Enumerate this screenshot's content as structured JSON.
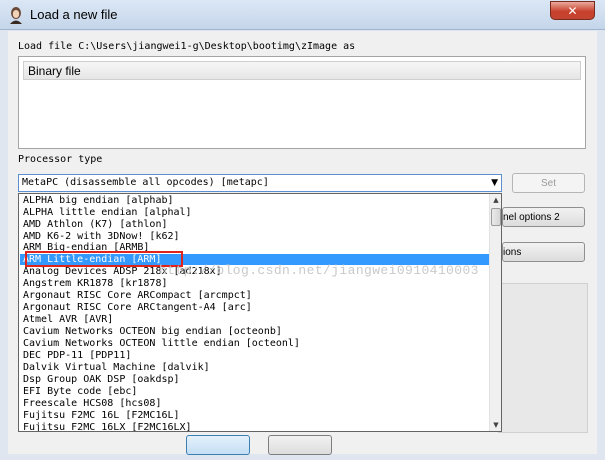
{
  "window": {
    "title": "Load a new file",
    "close_glyph": "✕"
  },
  "load_file": {
    "label": "Load file C:\\Users\\jiangwei1-g\\Desktop\\bootimg\\zImage as",
    "format_option": "Binary file"
  },
  "processor": {
    "label": "Processor type",
    "selected": "MetaPC (disassemble all opcodes) [metapc]",
    "set_button": "Set",
    "options": [
      "ALPHA big endian [alphab]",
      "ALPHA little endian [alphal]",
      "AMD Athlon (K7) [athlon]",
      "AMD K6-2 with 3DNow! [k62]",
      "ARM Big-endian [ARMB]",
      "ARM Little-endian [ARM]",
      "Analog Devices ADSP 218x [ad218x]",
      "Angstrem KR1878 [kr1878]",
      "Argonaut RISC Core ARCompact [arcmpct]",
      "Argonaut RISC Core ARCtangent-A4 [arc]",
      "Atmel AVR [AVR]",
      "Cavium Networks OCTEON big endian [octeonb]",
      "Cavium Networks OCTEON little endian [octeonl]",
      "DEC PDP-11 [PDP11]",
      "Dalvik Virtual Machine [dalvik]",
      "Dsp Group OAK DSP [oakdsp]",
      "EFI Byte code [ebc]",
      "Freescale HCS08 [hcs08]",
      "Fujitsu F2MC 16L [F2MC16L]",
      "Fujitsu F2MC 16LX [F2MC16LX]"
    ],
    "highlighted": "ARM Little-endian [ARM]"
  },
  "side_buttons": {
    "kernel_options_2": "nel options 2",
    "options": "ions"
  },
  "watermark": "http://blog.csdn.net/jiangwei0910410003",
  "colors": {
    "selection": "#3399ff",
    "highlight_box": "#e0231b"
  }
}
